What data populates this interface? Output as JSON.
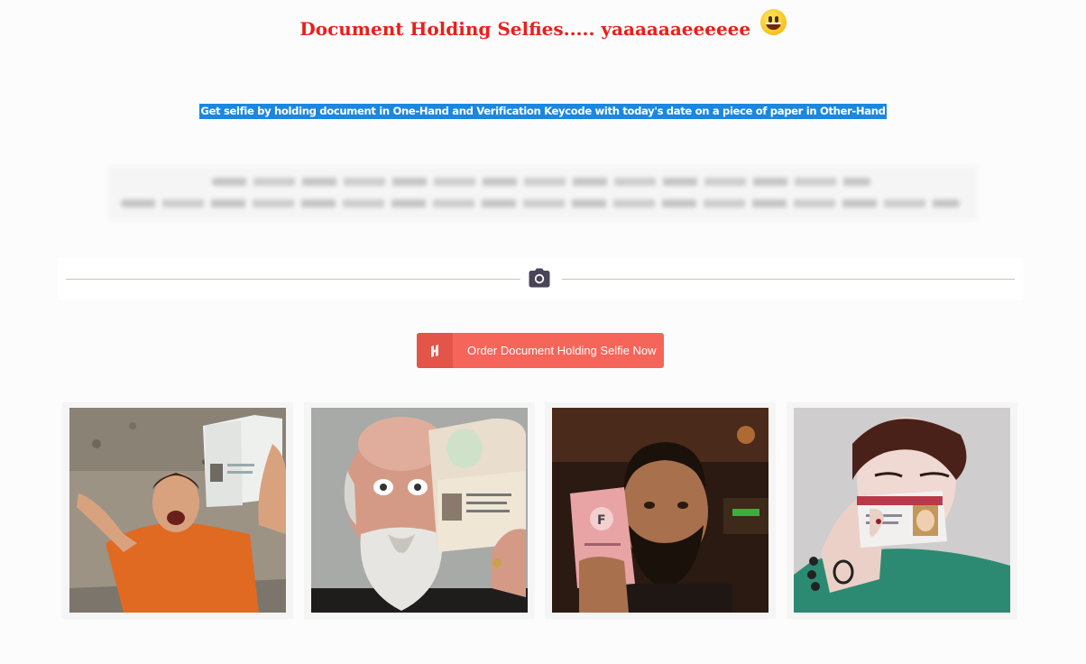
{
  "header": {
    "title": "Document Holding Selfies..... yaaaaaaeeeeee",
    "emoji_icon": "grinning-face-emoji"
  },
  "instructions": {
    "text": "Get selfie by holding document in One-Hand and Verification Keycode with today's date on a piece of paper in Other-Hand"
  },
  "divider": {
    "icon": "camera-icon",
    "line_color": "#cfc3b3"
  },
  "cta": {
    "label": "Order Document Holding Selfie Now",
    "icon": "brand-h-icon",
    "color": "#f6655a"
  },
  "gallery": {
    "items": [
      {
        "alt": "Man shouting holding open passport"
      },
      {
        "alt": "Bald bearded man holding passport"
      },
      {
        "alt": "Bearded man holding pink driving licence"
      },
      {
        "alt": "Woman holding ID card"
      }
    ]
  },
  "colors": {
    "title": "#e8201a",
    "highlight": "#1b87e0",
    "background": "#fcfcfc"
  }
}
